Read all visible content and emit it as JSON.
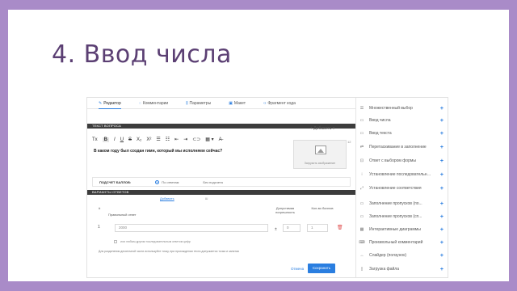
{
  "slide": {
    "title": "4. Ввод числа"
  },
  "editor": {
    "tabs": [
      {
        "label": "Редактор",
        "icon": "pencil-icon"
      },
      {
        "label": "Комментарии",
        "icon": "comment-icon"
      },
      {
        "label": "Параметры",
        "icon": "sliders-icon"
      },
      {
        "label": "Макет",
        "icon": "layout-icon"
      },
      {
        "label": "Фрагмент кода",
        "icon": "code-icon"
      }
    ],
    "question_section": "Текст вопроса",
    "add_button": "+ Добавить ▾",
    "toolbar": [
      "Tx",
      "B",
      "I",
      "U",
      "S",
      "X₂",
      "X²",
      "☰",
      "☷",
      "⇤",
      "⇥",
      "⊂⊃",
      "▦ ▾",
      "A̶"
    ],
    "question_text": "В каком году был создан гимн, который мы исполняем сейчас?",
    "image_caption": "Загрузить изображение",
    "image_number": "12",
    "scoring_label": "ПОДСЧЕТ БАЛЛОВ:",
    "scoring_options": [
      "По ответам",
      "Без подсчета"
    ],
    "answers_section": "Варианты ответов",
    "answers_add_link": "Добавить",
    "answers_other_link": "Ш",
    "col_hash": "#",
    "col_answer": "Правильный ответ",
    "col_tolerance": "Допустимая погрешность",
    "col_points": "Кол-во баллов",
    "row_index": "1",
    "answer_value": "2000",
    "plus_minus": "±",
    "tolerance_value": "0",
    "points_value": "1",
    "checkbox_text": "или любым другим последовательным ответом цифр",
    "note": "Для разделения десятичной части используйте точку, при прохождении теста допускается точка и запятая",
    "cancel": "Отмена",
    "save": "Сохранить"
  },
  "panel": {
    "items": [
      {
        "label": "Множественный выбор",
        "icon": "list-icon"
      },
      {
        "label": "Ввод числа",
        "icon": "number-icon"
      },
      {
        "label": "Ввод текста",
        "icon": "text-icon"
      },
      {
        "label": "Перетаскивание в заполнение",
        "icon": "drag-icon"
      },
      {
        "label": "Ответ с выбором формы",
        "icon": "form-icon"
      },
      {
        "label": "Установление последовательности",
        "icon": "order-icon"
      },
      {
        "label": "Установление соответствия",
        "icon": "match-icon"
      },
      {
        "label": "Заполнение пропусков (по...",
        "icon": "blank-icon"
      },
      {
        "label": "Заполнение пропусков (сп...",
        "icon": "blank-list-icon"
      },
      {
        "label": "Интерактивные диаграммы",
        "icon": "diagram-icon"
      },
      {
        "label": "Произвольный комментарий",
        "icon": "comment-box-icon"
      },
      {
        "label": "Слайдер (ползунок)",
        "icon": "slider-icon"
      },
      {
        "label": "Загрузка файла",
        "icon": "file-icon"
      }
    ]
  },
  "colors": {
    "accent": "#2a7ee0",
    "frame": "#a98bc8",
    "title": "#5b3f73"
  }
}
